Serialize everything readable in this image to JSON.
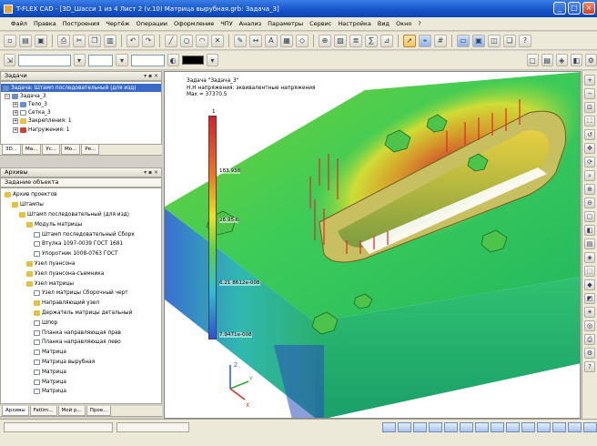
{
  "window": {
    "title": "T-FLEX CAD - [3D_Шасси 1 из 4 Лист 2 (v.10) Матрица вырубная.grb: Задача_3]",
    "min_label": "_",
    "max_label": "□",
    "close_label": "×"
  },
  "menu": [
    "Файл",
    "Правка",
    "Построения",
    "Чертёж",
    "Операции",
    "Оформление",
    "ЧПУ",
    "Анализ",
    "Параметры",
    "Сервис",
    "Настройка",
    "Вид",
    "Окно",
    "?"
  ],
  "model_panel": {
    "header": "Задачи",
    "root": "Задача: Штамп последовательный (для изд)",
    "items": [
      {
        "label": "Задача_3",
        "indent": 0,
        "sign": "−",
        "icon": "part"
      },
      {
        "label": "Тело_3",
        "indent": 1,
        "sign": "+",
        "icon": "part"
      },
      {
        "label": "Сетка_3",
        "indent": 1,
        "sign": "+",
        "icon": "doc"
      },
      {
        "label": "Закрепления: 1",
        "indent": 1,
        "sign": "+",
        "icon": "folder"
      },
      {
        "label": "Нагружения: 1",
        "indent": 1,
        "sign": "+",
        "icon": "red"
      }
    ],
    "tabs": [
      "3D...",
      "Ма...",
      "Ус...",
      "Мо...",
      "Ре..."
    ]
  },
  "struct_panel": {
    "header": "Архивы",
    "subheader": "Задание объекта",
    "items": [
      {
        "label": "Архив проектов",
        "indent": 0,
        "icon": "folder"
      },
      {
        "label": "Штампы",
        "indent": 1,
        "icon": "folder"
      },
      {
        "label": "Штамп последовательный (для изд)",
        "indent": 2,
        "icon": "folder"
      },
      {
        "label": "Модуль матрицы",
        "indent": 3,
        "icon": "folder"
      },
      {
        "label": "Штамп последовательный Сборк",
        "indent": 4,
        "icon": "doc"
      },
      {
        "label": "Втулка 1097-0039    ГОСТ 1681",
        "indent": 4,
        "icon": "doc"
      },
      {
        "label": "Упоротник 1008-0763    ГОСТ",
        "indent": 4,
        "icon": "doc"
      },
      {
        "label": "Узел пуансона",
        "indent": 3,
        "icon": "folder"
      },
      {
        "label": "Узел пуансона-съемника",
        "indent": 3,
        "icon": "folder"
      },
      {
        "label": "Узел матрицы",
        "indent": 3,
        "icon": "folder"
      },
      {
        "label": "Узел матрицы Сборочный черт",
        "indent": 4,
        "icon": "doc"
      },
      {
        "label": "Направляющий узел",
        "indent": 4,
        "icon": "folder"
      },
      {
        "label": "Держатель матрицы детальный",
        "indent": 4,
        "icon": "folder"
      },
      {
        "label": "Шпор",
        "indent": 4,
        "icon": "doc"
      },
      {
        "label": "Планка направляющая прав",
        "indent": 4,
        "icon": "doc"
      },
      {
        "label": "Планка направляющая лево",
        "indent": 4,
        "icon": "doc"
      },
      {
        "label": "Матрица",
        "indent": 4,
        "icon": "doc"
      },
      {
        "label": "Матрица вырубная",
        "indent": 4,
        "icon": "doc"
      },
      {
        "label": "Матрица",
        "indent": 4,
        "icon": "doc"
      },
      {
        "label": "Матрица",
        "indent": 4,
        "icon": "doc"
      },
      {
        "label": "Матрица",
        "indent": 4,
        "icon": "doc"
      }
    ],
    "tabs": [
      "Архивы",
      "Fatlim...",
      "Мой р...",
      "Прое..."
    ]
  },
  "viewport": {
    "info_lines": [
      "Задача \"Задача_3\"",
      "Н.Н напряжения: эквивалентные напряжения",
      "Max = 37370.5"
    ],
    "legend": {
      "max_label": "1",
      "labels": [
        {
          "text": "183.938",
          "frac": 0.25
        },
        {
          "text": "26.95·6",
          "frac": 0.47
        },
        {
          "text": "6.21 8612e-008",
          "frac": 0.75
        },
        {
          "text": "7.9471e-008",
          "frac": 0.985
        }
      ]
    },
    "axes": {
      "x": "X",
      "y": "Y",
      "z": "Z"
    }
  },
  "colors": {
    "accent": "#1552c8",
    "legend_top": "#d8202a",
    "legend_bottom": "#3050d8"
  }
}
